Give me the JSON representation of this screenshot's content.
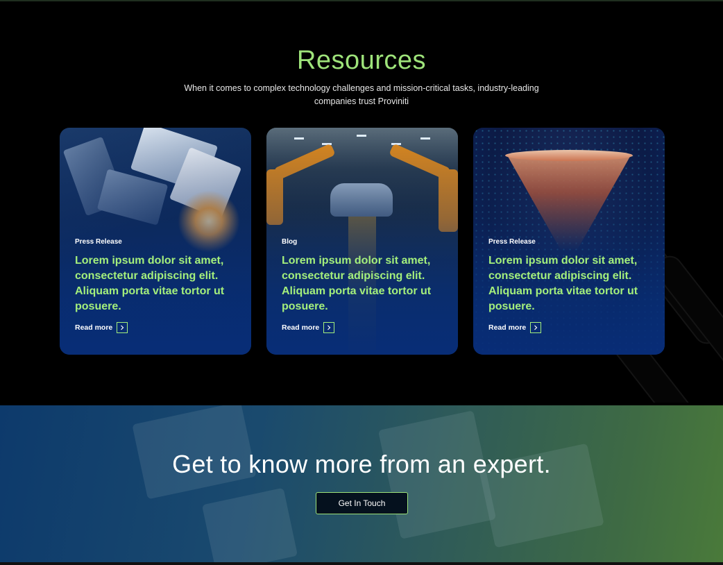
{
  "resources": {
    "title": "Resources",
    "subtitle": "When it comes to complex technology challenges and mission-critical tasks, industry-leading companies trust Proviniti"
  },
  "cards": [
    {
      "tag": "Press Release",
      "title": "Lorem ipsum dolor sit amet, consectetur adipiscing elit. Aliquam porta vitae tortor ut posuere.",
      "link_label": "Read more",
      "link_icon": "chevron-right-icon"
    },
    {
      "tag": "Blog",
      "title": "Lorem ipsum dolor sit amet, consectetur adipiscing elit. Aliquam porta vitae tortor ut posuere.",
      "link_label": "Read more",
      "link_icon": "chevron-right-icon"
    },
    {
      "tag": "Press Release",
      "title": "Lorem ipsum dolor sit amet, consectetur adipiscing elit. Aliquam porta vitae tortor ut posuere.",
      "link_label": "Read more",
      "link_icon": "chevron-right-icon"
    }
  ],
  "cta": {
    "title": "Get to know more from an expert.",
    "button_label": "Get In Touch"
  },
  "colors": {
    "accent_green": "#9ee37a",
    "background": "#000000",
    "card_blue": "#0a2d64"
  }
}
